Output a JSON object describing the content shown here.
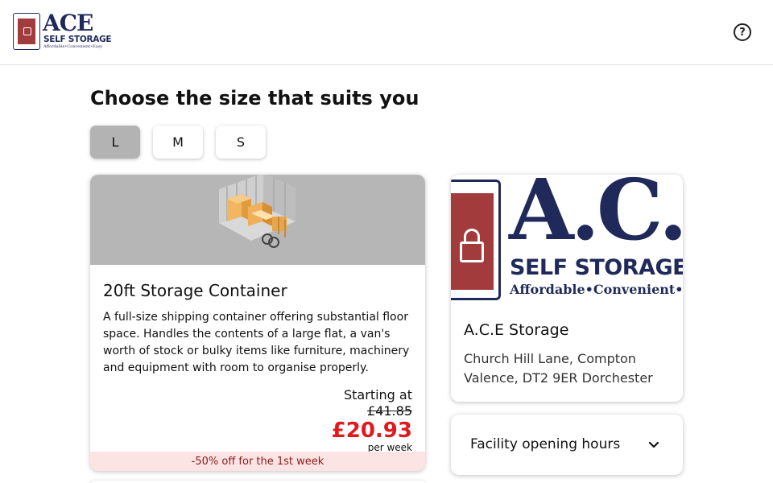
{
  "header": {
    "logo": {
      "name": "ACE",
      "subtitle": "SELF STORAGE",
      "tagline": "Affordable•Convenient•Easy"
    },
    "help_icon": "help-circle-icon",
    "help_glyph": "?"
  },
  "page": {
    "title": "Choose the size that suits you"
  },
  "size_tabs": [
    {
      "label": "L",
      "active": true
    },
    {
      "label": "M",
      "active": false
    },
    {
      "label": "S",
      "active": false
    }
  ],
  "unit": {
    "name": "20ft Storage Container",
    "description": "A full-size shipping container offering substantial floor space. Handles the contents of a large flat, a van's worth of stock or bulky items like furniture, machinery and equipment with room to organise properly.",
    "starting_label": "Starting at",
    "old_price": "£41.85",
    "new_price": "£20.93",
    "per_label": "per week",
    "discount": "-50% off for the 1st week"
  },
  "facility": {
    "logo": {
      "name": "A.C.E",
      "subtitle": "SELF STORAGE",
      "tagline": "Affordable•Convenient•Easy"
    },
    "name": "A.C.E Storage",
    "address": "Church Hill Lane, Compton Valence, DT2 9ER Dorchester"
  },
  "opening_hours": {
    "label": "Facility opening hours",
    "icon": "chevron-down-icon"
  },
  "colors": {
    "brand_navy": "#1f2a5a",
    "brand_red": "#a23b3b",
    "price_red": "#e0191e",
    "active_tab": "#b3b3b3",
    "discount_bg": "#fde4e4"
  }
}
